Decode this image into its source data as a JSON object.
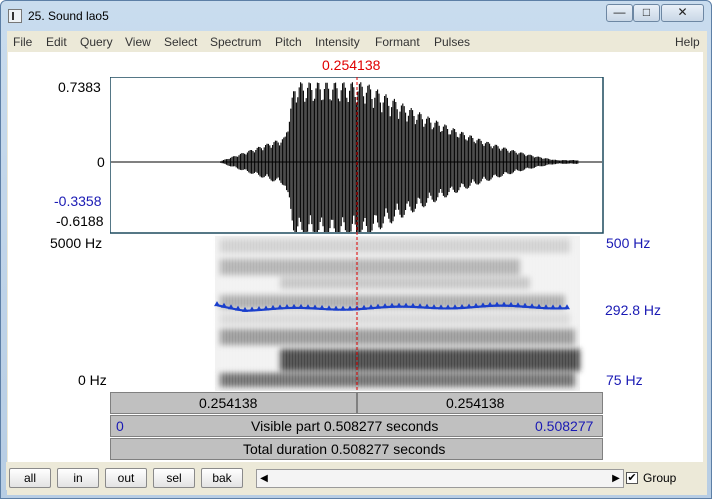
{
  "window": {
    "title": "25. Sound lao5",
    "min_glyph": "—",
    "max_glyph": "□",
    "close_glyph": "✕"
  },
  "menu": [
    "File",
    "Edit",
    "Query",
    "View",
    "Select",
    "Spectrum",
    "Pitch",
    "Intensity",
    "Formant",
    "Pulses"
  ],
  "help": "Help",
  "cursor": {
    "time": "0.254138"
  },
  "waveform": {
    "max_label": "0.7383",
    "zero_label": "0",
    "blue_label": "-0.3358",
    "min_label": "-0.6188"
  },
  "spectrogram": {
    "top_label": "5000 Hz",
    "bottom_label": "0 Hz"
  },
  "pitch": {
    "top_label": "500 Hz",
    "value_label": "292.8 Hz",
    "bottom_label": "75 Hz"
  },
  "info": {
    "left_time": "0.254138",
    "right_time": "0.254138",
    "visible_start": "0",
    "visible_text": "Visible part 0.508277 seconds",
    "visible_end": "0.508277",
    "total_text": "Total duration 0.508277 seconds"
  },
  "buttons": {
    "all": "all",
    "in": "in",
    "out": "out",
    "sel": "sel",
    "bak": "bak"
  },
  "scroll": {
    "left_arrow": "◀",
    "right_arrow": "▶"
  },
  "group": {
    "checked_glyph": "✔",
    "label": "Group"
  },
  "colors": {
    "cursor": "#e00000",
    "pitch_line": "#1a3fcc",
    "axis_blue": "#1a1ab4"
  }
}
